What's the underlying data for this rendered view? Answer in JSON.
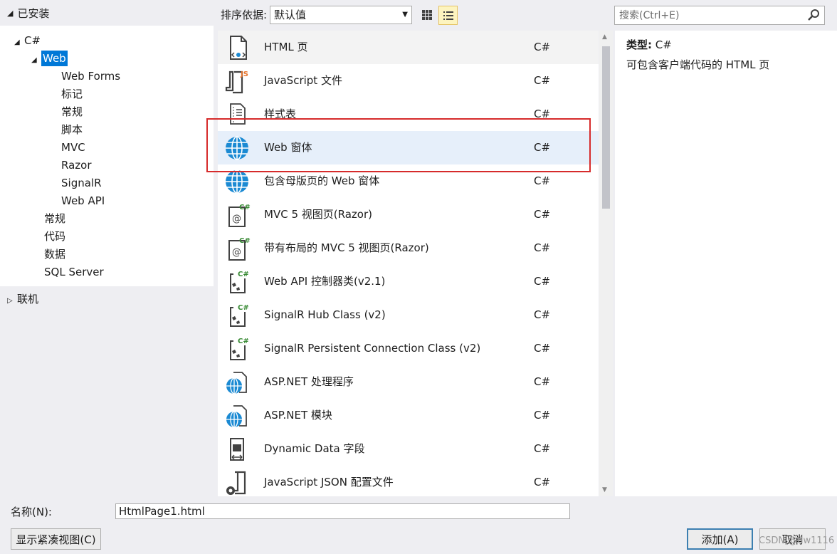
{
  "tree": {
    "header": "已安装",
    "root": "C#",
    "web": "Web",
    "web_children": [
      "Web Forms",
      "标记",
      "常规",
      "脚本",
      "MVC",
      "Razor",
      "SignalR",
      "Web API"
    ],
    "others": [
      "常规",
      "代码",
      "数据",
      "SQL Server"
    ],
    "online": "联机"
  },
  "toolbar": {
    "sort_label": "排序依据:",
    "sort_value": "默认值",
    "search_placeholder": "搜索(Ctrl+E)"
  },
  "templates": [
    {
      "name": "HTML 页",
      "lang": "C#",
      "icon": "html-file-icon"
    },
    {
      "name": "JavaScript 文件",
      "lang": "C#",
      "icon": "javascript-file-icon"
    },
    {
      "name": "样式表",
      "lang": "C#",
      "icon": "stylesheet-icon"
    },
    {
      "name": "Web 窗体",
      "lang": "C#",
      "icon": "globe-icon"
    },
    {
      "name": "包含母版页的 Web 窗体",
      "lang": "C#",
      "icon": "globe-icon"
    },
    {
      "name": "MVC 5 视图页(Razor)",
      "lang": "C#",
      "icon": "razor-view-icon"
    },
    {
      "name": "带有布局的 MVC 5 视图页(Razor)",
      "lang": "C#",
      "icon": "razor-view-icon"
    },
    {
      "name": "Web API 控制器类(v2.1)",
      "lang": "C#",
      "icon": "csharp-class-icon"
    },
    {
      "name": "SignalR Hub Class (v2)",
      "lang": "C#",
      "icon": "csharp-class-icon"
    },
    {
      "name": "SignalR Persistent Connection Class (v2)",
      "lang": "C#",
      "icon": "csharp-class-icon"
    },
    {
      "name": "ASP.NET 处理程序",
      "lang": "C#",
      "icon": "globe-file-icon"
    },
    {
      "name": "ASP.NET 模块",
      "lang": "C#",
      "icon": "globe-file-icon"
    },
    {
      "name": "Dynamic Data 字段",
      "lang": "C#",
      "icon": "dynamic-data-icon"
    },
    {
      "name": "JavaScript JSON 配置文件",
      "lang": "C#",
      "icon": "json-config-icon"
    }
  ],
  "description": {
    "type_label": "类型:",
    "type_value": "C#",
    "text": "可包含客户端代码的 HTML 页"
  },
  "bottom": {
    "name_label": "名称(N):",
    "name_value": "HtmlPage1.html",
    "compact_button": "显示紧凑视图(C)",
    "add_button": "添加(A)",
    "cancel_button": "取消"
  },
  "watermark": "CSDN @dw1116",
  "colors": {
    "selection": "#0078d7",
    "annotation": "#d62b2b",
    "globe": "#1b8ad3"
  }
}
